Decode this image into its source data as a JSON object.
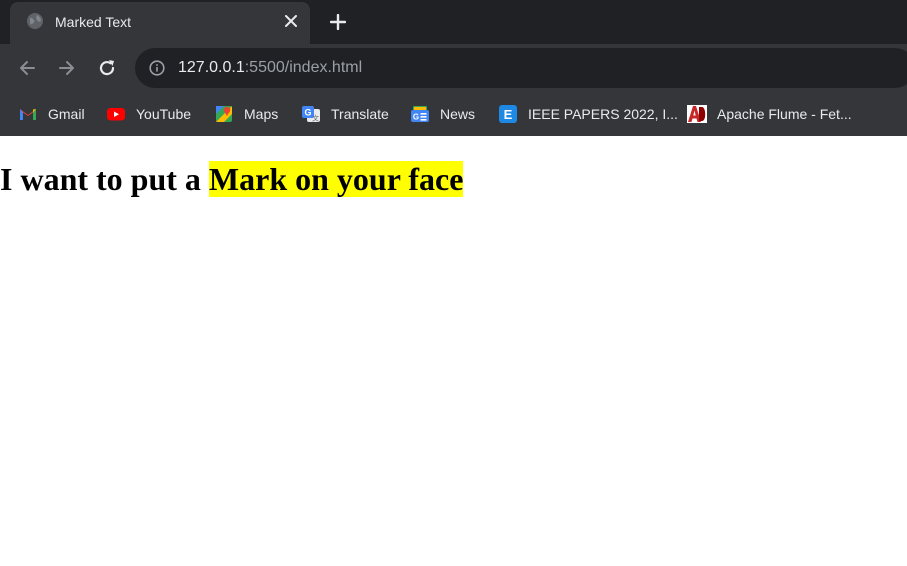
{
  "browser": {
    "tab": {
      "title": "Marked Text"
    },
    "address_bar": {
      "host": "127.0.0.1",
      "rest": ":5500/index.html"
    },
    "bookmarks": [
      {
        "label": "Gmail",
        "icon": "gmail-icon"
      },
      {
        "label": "YouTube",
        "icon": "youtube-icon"
      },
      {
        "label": "Maps",
        "icon": "maps-icon"
      },
      {
        "label": "Translate",
        "icon": "translate-icon"
      },
      {
        "label": "News",
        "icon": "news-icon"
      },
      {
        "label": "IEEE PAPERS 2022, I...",
        "icon": "ieee-icon"
      },
      {
        "label": "Apache Flume - Fet...",
        "icon": "apache-flume-icon"
      }
    ]
  },
  "page": {
    "heading_plain": "I want to put a ",
    "heading_marked": "Mark on your face"
  },
  "colors": {
    "tabstrip": "#202124",
    "toolbar": "#35363a",
    "omnibox": "#202124",
    "highlight": "#ffff00"
  }
}
